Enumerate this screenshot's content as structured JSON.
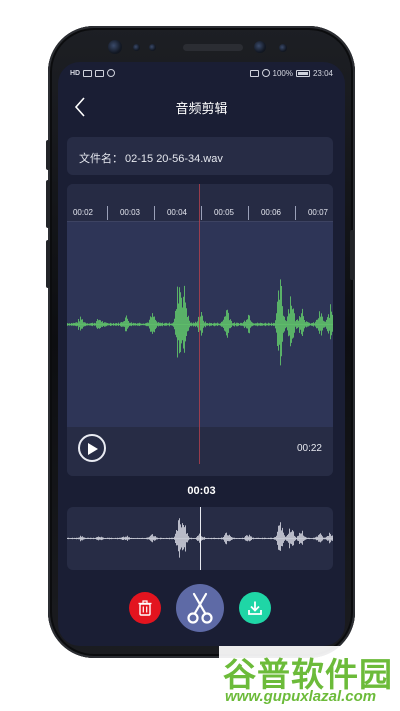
{
  "status_bar": {
    "carrier_left": "HD",
    "battery": "100%",
    "time": "23:04"
  },
  "header": {
    "title": "音频剪辑"
  },
  "file": {
    "label": "文件名：",
    "name": "02-15 20-56-34.wav"
  },
  "timeline": {
    "ticks": [
      "00:02",
      "00:03",
      "00:04",
      "00:05",
      "00:06",
      "00:07"
    ]
  },
  "player": {
    "duration": "00:22",
    "current_time": "00:03"
  },
  "actions": {
    "delete": "delete",
    "cut": "cut",
    "save": "save"
  },
  "colors": {
    "screen_bg": "#1a1e34",
    "card_bg": "#272c45",
    "waveform": "#5fc06a",
    "overview_wave": "#c9cbd6",
    "playhead": "#b5414e",
    "delete": "#e3141f",
    "cut": "#5e6aa6",
    "save": "#1fd6a6"
  },
  "icons": {
    "back": "chevron-left-icon",
    "play": "play-icon",
    "delete": "trash-icon",
    "cut": "scissors-icon",
    "save": "download-icon"
  },
  "watermark": {
    "logo": "谷普软件园",
    "url": "www.gupuxlazal.com"
  }
}
